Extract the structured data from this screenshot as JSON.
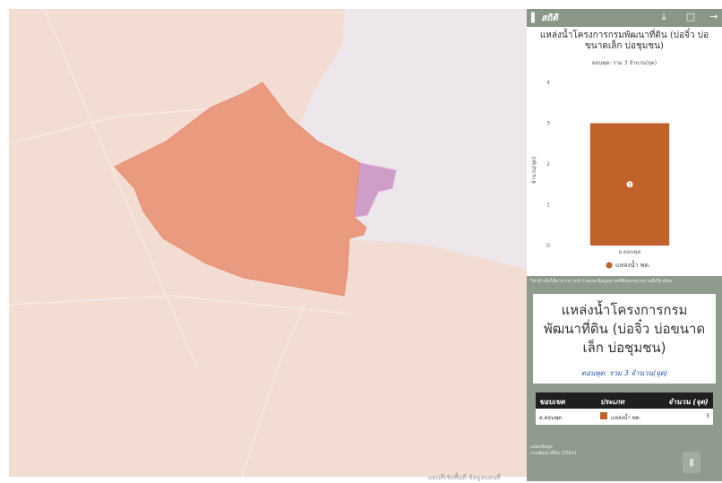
{
  "colors": {
    "map_background": "#ede6ea",
    "province_fill": "#f3ddd3",
    "district_fill": "#ea9a7f",
    "adjacent_fill": "#cf9ec8",
    "panel_background": "#8f9b8c",
    "bar_color": "#c0622a",
    "table_header": "#1f1f1f",
    "subtitle_blue": "#2d5aa8"
  },
  "header": {
    "brand": "สถิติ",
    "icons": [
      "signal-icon",
      "download-icon",
      "fullscreen-icon",
      "exit-icon"
    ]
  },
  "map": {
    "attribution": "แผนที่เชิงพื้นที่ ข้อมูลแผนที่"
  },
  "chart_card": {
    "title": "แหล่งน้ำโครงการกรมพัฒนาที่ดิน (บ่อจิ๋ว บ่อขนาดเล็ก บ่อชุมชน)",
    "subtitle": "ดอนพุด: รวม 3 จำนวน(จุด)"
  },
  "chart_data": {
    "type": "bar",
    "title": "แหล่งน้ำโครงการกรมพัฒนาที่ดิน (บ่อจิ๋ว บ่อขนาดเล็ก บ่อชุมชน)",
    "subtitle": "ดอนพุด: รวม 3 จำนวน(จุด)",
    "categories": [
      "อ.ดอนพุด"
    ],
    "series": [
      {
        "name": "แหล่งน้ำ พด.",
        "values": [
          3
        ]
      }
    ],
    "data_labels": [
      "3"
    ],
    "xlabel": "",
    "ylabel": "จำนวน(จุด)",
    "ylim": [
      0,
      4
    ],
    "yticks": [
      "0",
      "1",
      "2",
      "3",
      "4"
    ],
    "grid": false,
    "legend_position": "bottom"
  },
  "source_note": "*ค่าอ้างอิงได้มาจากการสำรวจและข้อมูลทางสถิติของหน่วยงานที่เกี่ยวข้อง",
  "info_card": {
    "title": "แหล่งน้ำโครงการกรมพัฒนาที่ดิน (บ่อจิ๋ว บ่อขนาดเล็ก บ่อชุมชน)",
    "subtitle": "ดอนพุด: รวม 3 จำนวน(จุด)"
  },
  "table": {
    "headers": [
      "ขอบเขต",
      "ประเภท",
      "จำนวน (จุด)"
    ],
    "rows": [
      {
        "area": "อ.ดอนพุด",
        "type": "แหล่งน้ำ พด.",
        "count": "3"
      }
    ]
  },
  "footer": {
    "line1": "แหล่งข้อมูล",
    "line2": "กรมพัฒนาที่ดิน (2562)"
  }
}
